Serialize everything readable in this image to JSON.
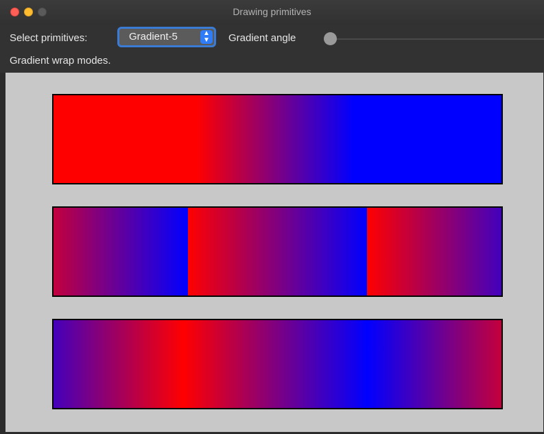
{
  "window": {
    "title": "Drawing primitives"
  },
  "toolbar": {
    "select_label": "Select primitives:",
    "select_value": "Gradient-5",
    "angle_label": "Gradient angle",
    "angle_value_fraction": 0.0,
    "description": "Gradient wrap modes."
  },
  "canvas": {
    "background": "#c8c8c8",
    "bars": [
      {
        "mode": "pad",
        "colors": [
          "#ff0000",
          "#0000ff"
        ]
      },
      {
        "mode": "repeat",
        "colors": [
          "#ff0000",
          "#0000ff"
        ]
      },
      {
        "mode": "reflect",
        "colors": [
          "#ff0000",
          "#0000ff"
        ]
      }
    ]
  },
  "icons": {
    "close": "close-button-icon",
    "minimize": "minimize-button-icon",
    "zoom": "zoom-button-icon",
    "stepper": "chevron-up-down-icon"
  }
}
